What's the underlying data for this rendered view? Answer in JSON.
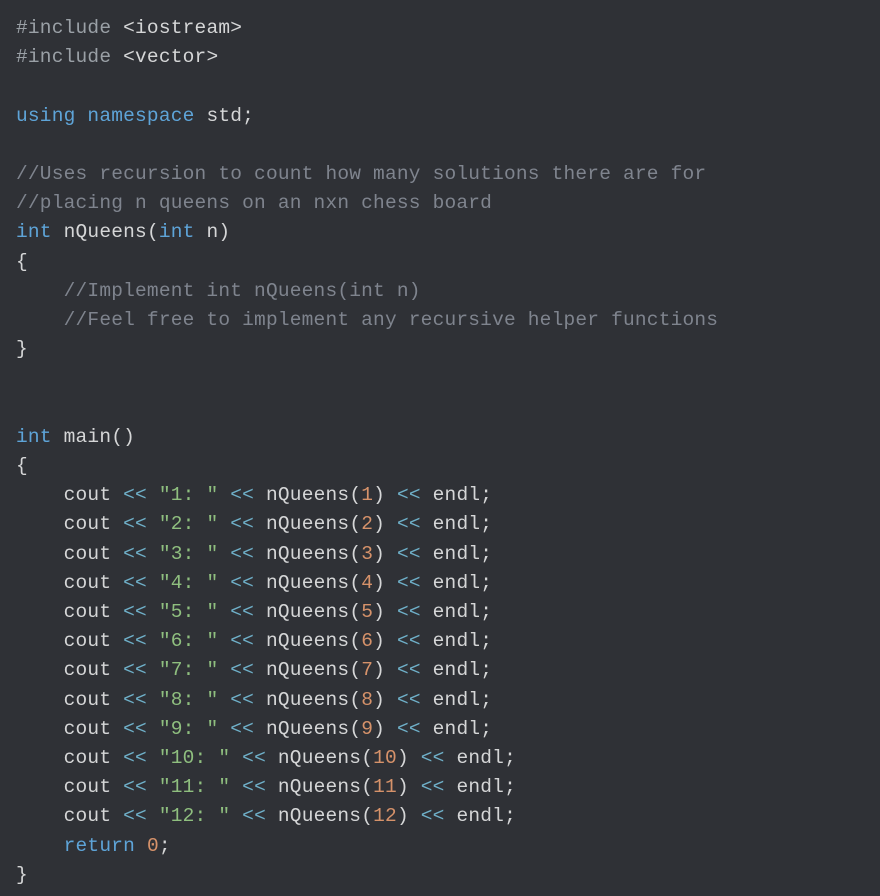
{
  "code": {
    "include1_directive": "#include",
    "include1_header": "<iostream>",
    "include2_directive": "#include",
    "include2_header": "<vector>",
    "using": "using",
    "namespace": "namespace",
    "std": "std",
    "semicolon": ";",
    "comment_fn1": "//Uses recursion to count how many solutions there are for",
    "comment_fn2": "//placing n queens on an nxn chess board",
    "int": "int",
    "nQueens": "nQueens",
    "lparen": "(",
    "rparen": ")",
    "n": "n",
    "lbrace": "{",
    "rbrace": "}",
    "comment_impl1": "//Implement int nQueens(int n)",
    "comment_impl2": "//Feel free to implement any recursive helper functions",
    "main": "main",
    "cout": "cout",
    "llop": "<<",
    "endl": "endl",
    "return": "return",
    "zero": "0",
    "calls": [
      {
        "label": "\"1: \"",
        "arg": "1"
      },
      {
        "label": "\"2: \"",
        "arg": "2"
      },
      {
        "label": "\"3: \"",
        "arg": "3"
      },
      {
        "label": "\"4: \"",
        "arg": "4"
      },
      {
        "label": "\"5: \"",
        "arg": "5"
      },
      {
        "label": "\"6: \"",
        "arg": "6"
      },
      {
        "label": "\"7: \"",
        "arg": "7"
      },
      {
        "label": "\"8: \"",
        "arg": "8"
      },
      {
        "label": "\"9: \"",
        "arg": "9"
      },
      {
        "label": "\"10: \"",
        "arg": "10"
      },
      {
        "label": "\"11: \"",
        "arg": "11"
      },
      {
        "label": "\"12: \"",
        "arg": "12"
      }
    ]
  }
}
